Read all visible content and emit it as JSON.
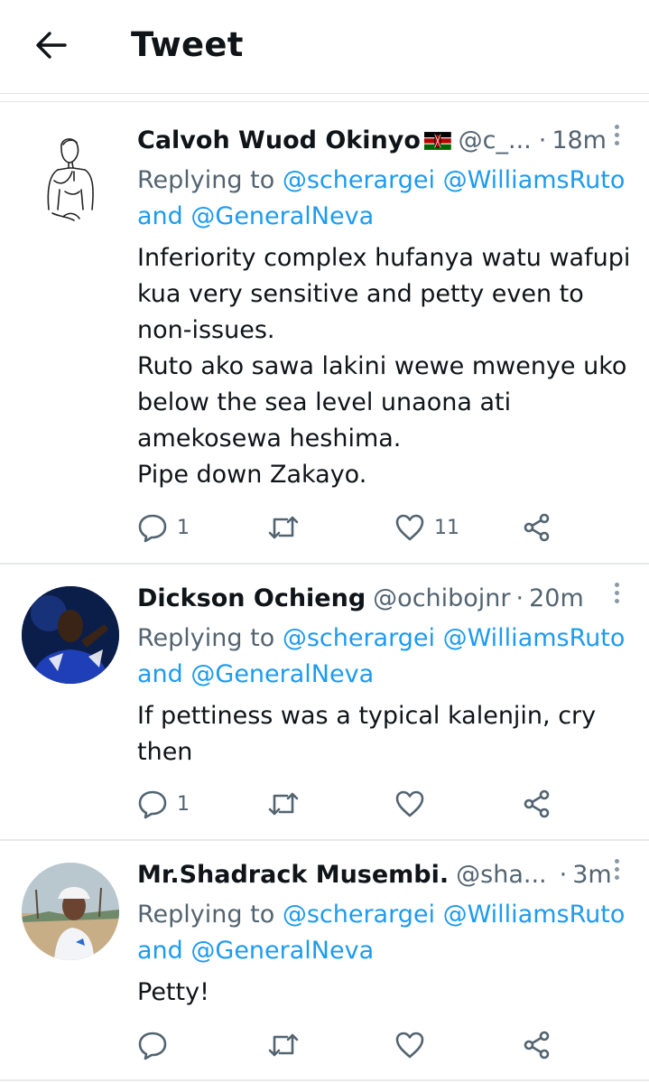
{
  "header": {
    "title": "Tweet",
    "back_icon": "arrow-left-icon"
  },
  "colors": {
    "accent": "#1d9bf0",
    "secondary_text": "#536471",
    "primary_text": "#0f1419"
  },
  "tweets": [
    {
      "name": "Calvoh Wuod Okinyo",
      "flag": "kenya-flag-emoji",
      "handle": "@c_...",
      "time": "18m",
      "replying_prefix": "Replying to",
      "mention_1": "@scherargei",
      "mention_2": "@WilliamsRuto",
      "and_text": "and",
      "mention_3": "@GeneralNeva",
      "body_lines": [
        "Inferiority complex hufanya watu wafupi",
        "kua very sensitive and petty even to",
        "non-issues.",
        "Ruto ako sawa lakini wewe mwenye uko",
        "below the sea level unaona ati",
        "amekosewa heshima.",
        "Pipe down Zakayo."
      ],
      "replies": "1",
      "retweets": "",
      "likes": "11"
    },
    {
      "name": "Dickson Ochieng",
      "handle": "@ochibojnr",
      "time": "20m",
      "replying_prefix": "Replying to",
      "mention_1": "@scherargei",
      "mention_2": "@WilliamsRuto",
      "and_text": "and",
      "mention_3": "@GeneralNeva",
      "body_lines": [
        "If pettiness was a typical kalenjin, cry",
        "then"
      ],
      "replies": "1",
      "retweets": "",
      "likes": ""
    },
    {
      "name": "Mr.Shadrack Musembi.",
      "handle": "@sha...",
      "time": "3m",
      "replying_prefix": "Replying to",
      "mention_1": "@scherargei",
      "mention_2": "@WilliamsRuto",
      "and_text": "and",
      "mention_3": "@GeneralNeva",
      "body_lines": [
        "Petty!"
      ],
      "replies": "",
      "retweets": "",
      "likes": ""
    }
  ]
}
